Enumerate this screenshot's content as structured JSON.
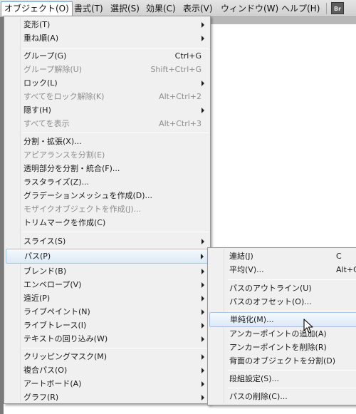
{
  "menubar": {
    "items": [
      {
        "label": "オブジェクト(O)"
      },
      {
        "label": "書式(T)"
      },
      {
        "label": "選択(S)"
      },
      {
        "label": "効果(C)"
      },
      {
        "label": "表示(V)"
      },
      {
        "label": "ウィンドウ(W)"
      },
      {
        "label": "ヘルプ(H)"
      }
    ],
    "badge": "Br"
  },
  "menu": {
    "items": [
      {
        "label": "変形(T)",
        "shortcut": "",
        "submenu": true,
        "disabled": false
      },
      {
        "label": "重ね順(A)",
        "shortcut": "",
        "submenu": true,
        "disabled": false
      },
      {
        "label": "グループ(G)",
        "shortcut": "Ctrl+G",
        "submenu": false,
        "disabled": false
      },
      {
        "label": "グループ解除(U)",
        "shortcut": "Shift+Ctrl+G",
        "submenu": false,
        "disabled": true
      },
      {
        "label": "ロック(L)",
        "shortcut": "",
        "submenu": true,
        "disabled": false
      },
      {
        "label": "すべてをロック解除(K)",
        "shortcut": "Alt+Ctrl+2",
        "submenu": false,
        "disabled": true
      },
      {
        "label": "隠す(H)",
        "shortcut": "",
        "submenu": true,
        "disabled": false
      },
      {
        "label": "すべてを表示",
        "shortcut": "Alt+Ctrl+3",
        "submenu": false,
        "disabled": true
      },
      {
        "label": "分割・拡張(X)...",
        "shortcut": "",
        "submenu": false,
        "disabled": false
      },
      {
        "label": "アピアランスを分割(E)",
        "shortcut": "",
        "submenu": false,
        "disabled": true
      },
      {
        "label": "透明部分を分割・統合(F)...",
        "shortcut": "",
        "submenu": false,
        "disabled": false
      },
      {
        "label": "ラスタライズ(Z)...",
        "shortcut": "",
        "submenu": false,
        "disabled": false
      },
      {
        "label": "グラデーションメッシュを作成(D)...",
        "shortcut": "",
        "submenu": false,
        "disabled": false
      },
      {
        "label": "モザイクオブジェクトを作成(J)...",
        "shortcut": "",
        "submenu": false,
        "disabled": true
      },
      {
        "label": "トリムマークを作成(C)",
        "shortcut": "",
        "submenu": false,
        "disabled": false
      },
      {
        "label": "スライス(S)",
        "shortcut": "",
        "submenu": true,
        "disabled": false
      },
      {
        "label": "パス(P)",
        "shortcut": "",
        "submenu": true,
        "disabled": false,
        "highlighted": true
      },
      {
        "label": "ブレンド(B)",
        "shortcut": "",
        "submenu": true,
        "disabled": false
      },
      {
        "label": "エンベロープ(V)",
        "shortcut": "",
        "submenu": true,
        "disabled": false
      },
      {
        "label": "遠近(P)",
        "shortcut": "",
        "submenu": true,
        "disabled": false
      },
      {
        "label": "ライブペイント(N)",
        "shortcut": "",
        "submenu": true,
        "disabled": false
      },
      {
        "label": "ライブトレース(I)",
        "shortcut": "",
        "submenu": true,
        "disabled": false
      },
      {
        "label": "テキストの回り込み(W)",
        "shortcut": "",
        "submenu": true,
        "disabled": false
      },
      {
        "label": "クリッピングマスク(M)",
        "shortcut": "",
        "submenu": true,
        "disabled": false
      },
      {
        "label": "複合パス(O)",
        "shortcut": "",
        "submenu": true,
        "disabled": false
      },
      {
        "label": "アートボード(A)",
        "shortcut": "",
        "submenu": true,
        "disabled": false
      },
      {
        "label": "グラフ(R)",
        "shortcut": "",
        "submenu": true,
        "disabled": false
      }
    ]
  },
  "submenu": {
    "items": [
      {
        "label": "連結(J)",
        "shortcut": "C"
      },
      {
        "label": "平均(V)...",
        "shortcut": "Alt+C"
      },
      {
        "label": "パスのアウトライン(U)",
        "shortcut": ""
      },
      {
        "label": "パスのオフセット(O)...",
        "shortcut": ""
      },
      {
        "label": "単純化(M)...",
        "shortcut": "",
        "highlighted": true
      },
      {
        "label": "アンカーポイントの追加(A)",
        "shortcut": ""
      },
      {
        "label": "アンカーポイントを削除(R)",
        "shortcut": ""
      },
      {
        "label": "背面のオブジェクトを分割(D)",
        "shortcut": ""
      },
      {
        "label": "段組設定(S)...",
        "shortcut": ""
      },
      {
        "label": "パスの削除(C)...",
        "shortcut": ""
      }
    ]
  },
  "colors": {
    "menu_bg": "#f0f0f0",
    "highlight_border": "#a7c3e4",
    "disabled_text": "#8d8d8d"
  }
}
